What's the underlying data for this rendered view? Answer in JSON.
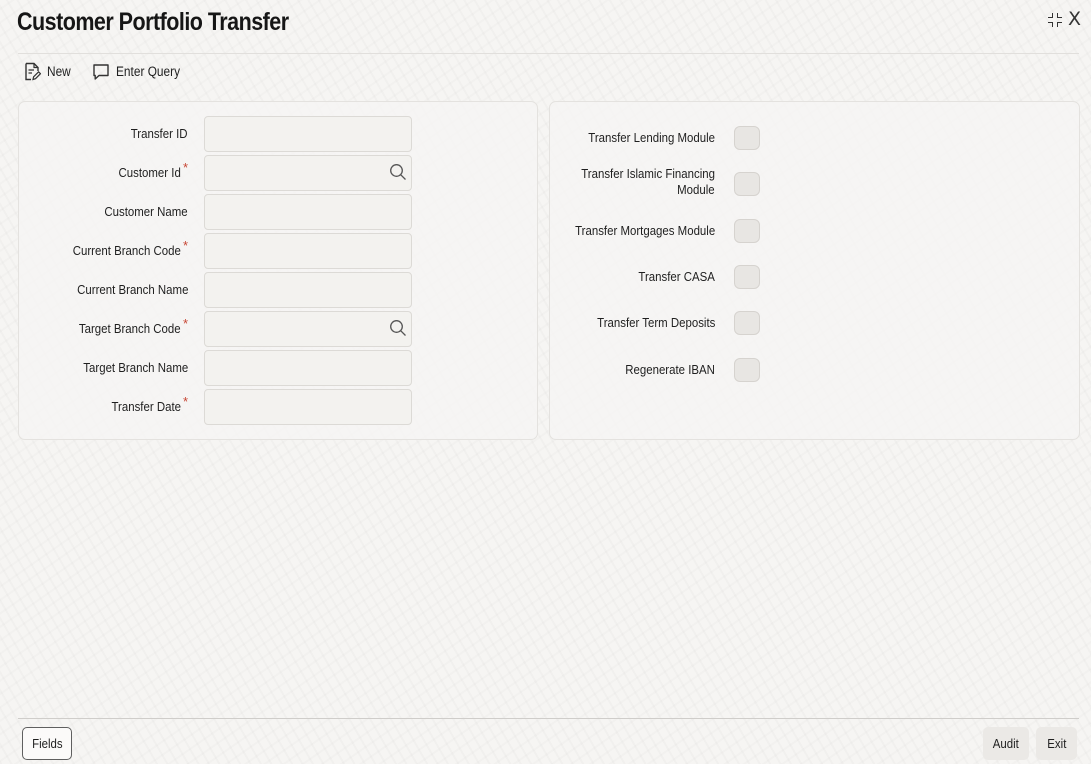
{
  "window": {
    "title": "Customer Portfolio Transfer"
  },
  "toolbar": {
    "new_label": "New",
    "enter_query_label": "Enter Query"
  },
  "left_fields": [
    {
      "label": "Transfer ID",
      "required": false,
      "value": "",
      "has_lookup": false
    },
    {
      "label": "Customer Id",
      "required": true,
      "value": "",
      "has_lookup": true
    },
    {
      "label": "Customer Name",
      "required": false,
      "value": "",
      "has_lookup": false
    },
    {
      "label": "Current Branch Code",
      "required": true,
      "value": "",
      "has_lookup": false
    },
    {
      "label": "Current Branch Name",
      "required": false,
      "value": "",
      "has_lookup": false
    },
    {
      "label": "Target Branch Code",
      "required": true,
      "value": "",
      "has_lookup": true
    },
    {
      "label": "Target Branch Name",
      "required": false,
      "value": "",
      "has_lookup": false
    },
    {
      "label": "Transfer Date",
      "required": true,
      "value": "",
      "has_lookup": false
    }
  ],
  "required_marker": "*",
  "right_toggles": [
    {
      "label": "Transfer Lending Module",
      "checked": false
    },
    {
      "label_line1": "Transfer Islamic Financing",
      "label_line2": "Module",
      "checked": false
    },
    {
      "label": "Transfer Mortgages Module",
      "checked": false
    },
    {
      "label": "Transfer CASA",
      "checked": false
    },
    {
      "label": "Transfer Term Deposits",
      "checked": false
    },
    {
      "label": "Regenerate IBAN",
      "checked": false
    }
  ],
  "footer": {
    "fields_label": "Fields",
    "audit_label": "Audit",
    "exit_label": "Exit"
  },
  "colors": {
    "required": "#c74634",
    "toggle_off": "#e8e6e3",
    "background": "#f6f5f3"
  },
  "icons": [
    "new-document-icon",
    "enter-query-icon",
    "search-icon",
    "collapse-icon",
    "close-icon"
  ]
}
